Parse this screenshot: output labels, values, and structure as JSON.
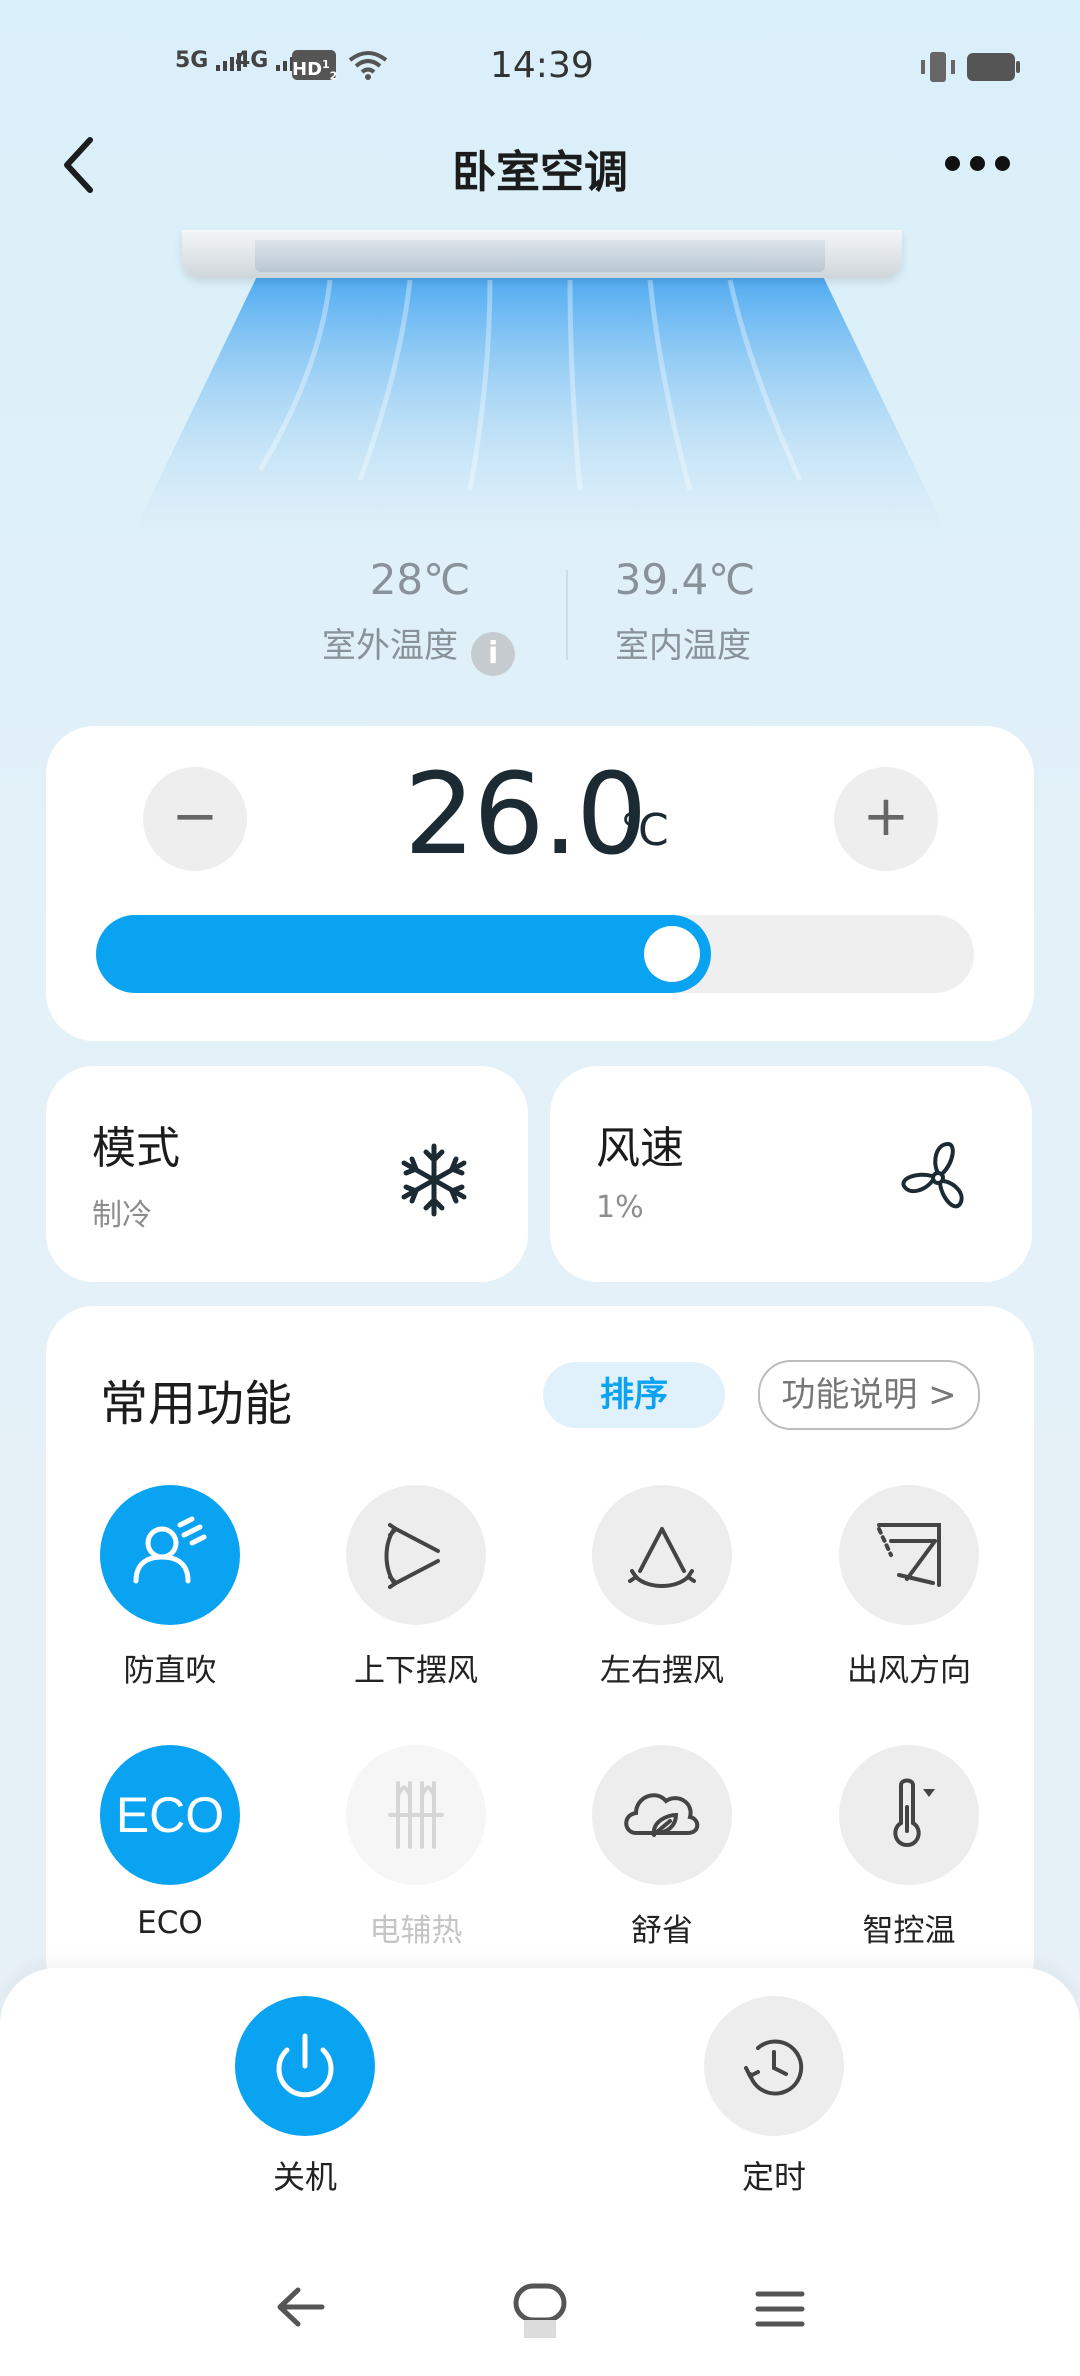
{
  "status_bar": {
    "time": "14:39",
    "signal1": "5G",
    "signal2": "4G",
    "hd": "HD",
    "hd_sub1": "1",
    "hd_sub2": "2"
  },
  "header": {
    "title": "卧室空调"
  },
  "temps": {
    "outdoor_value": "28℃",
    "outdoor_label": "室外温度",
    "indoor_value": "39.4℃",
    "indoor_label": "室内温度"
  },
  "temp_control": {
    "minus": "−",
    "plus": "+",
    "setpoint": "26.0",
    "unit": "℃",
    "slider_fraction": 0.7
  },
  "mode": {
    "title": "模式",
    "value": "制冷",
    "icon": "snowflake-icon"
  },
  "fan": {
    "title": "风速",
    "value": "1%",
    "icon": "fan-icon"
  },
  "functions": {
    "title": "常用功能",
    "sort_label": "排序",
    "help_label": "功能说明 >",
    "items": [
      {
        "label": "防直吹",
        "icon": "anti-direct-wind-icon",
        "active": true
      },
      {
        "label": "上下摆风",
        "icon": "vertical-swing-icon",
        "active": false
      },
      {
        "label": "左右摆风",
        "icon": "horizontal-swing-icon",
        "active": false
      },
      {
        "label": "出风方向",
        "icon": "wind-direction-icon",
        "active": false
      },
      {
        "label": "ECO",
        "icon": "eco-icon",
        "active": true
      },
      {
        "label": "电辅热",
        "icon": "electric-heat-icon",
        "active": false,
        "disabled": true
      },
      {
        "label": "舒省",
        "icon": "comfort-save-icon",
        "active": false
      },
      {
        "label": "智控温",
        "icon": "smart-temp-icon",
        "active": false
      }
    ],
    "eco_text": "ECO"
  },
  "bottom_bar": {
    "power_label": "关机",
    "timer_label": "定时"
  },
  "colors": {
    "accent": "#0aa3f2",
    "background": "#e3f1f8"
  }
}
